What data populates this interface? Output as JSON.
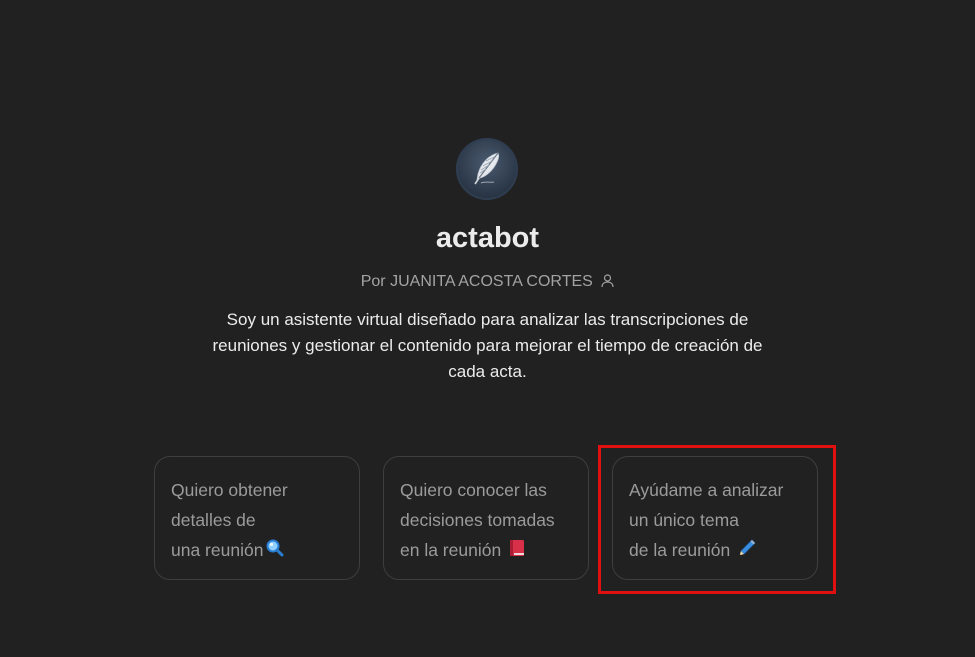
{
  "gpt": {
    "name": "actabot",
    "byline_prefix": "Por",
    "author": "JUANITA ACOSTA CORTES",
    "author_icon": "user-icon",
    "avatar_icon": "quill-feather-icon",
    "description": "Soy un asistente virtual diseñado para analizar las transcripciones de reuniones y gestionar el contenido para mejorar el tiempo de creación de cada acta."
  },
  "starters": [
    {
      "lines": [
        "Quiero obtener",
        "detalles de",
        "una reunión"
      ],
      "icon": "magnifier-icon"
    },
    {
      "lines": [
        "Quiero conocer las",
        "decisiones tomadas",
        "en la reunión "
      ],
      "icon": "red-book-icon"
    },
    {
      "lines": [
        "Ayúdame a analizar",
        "un único tema",
        "de la reunión "
      ],
      "icon": "pen-icon"
    }
  ],
  "colors": {
    "background": "#212121",
    "text_primary": "#ececec",
    "text_secondary": "#9b9b9b",
    "card_border": "#3e3e3e",
    "highlight": "#e01010"
  }
}
